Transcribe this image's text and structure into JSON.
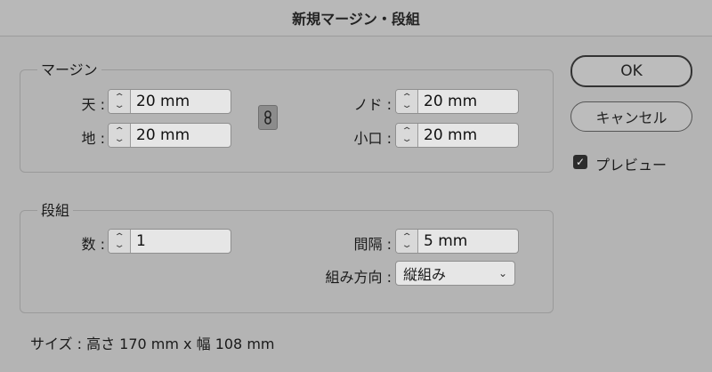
{
  "window": {
    "title": "新規マージン・段組"
  },
  "margins": {
    "group_label": "マージン",
    "top": {
      "label": "天 :",
      "value": "20 mm"
    },
    "bottom": {
      "label": "地 :",
      "value": "20 mm"
    },
    "inside": {
      "label": "ノド :",
      "value": "20 mm"
    },
    "outside": {
      "label": "小口 :",
      "value": "20 mm"
    }
  },
  "columns": {
    "group_label": "段組",
    "count": {
      "label": "数 :",
      "value": "1"
    },
    "gutter": {
      "label": "間隔 :",
      "value": "5 mm"
    },
    "direction": {
      "label": "組み方向 :",
      "value": "縦組み"
    }
  },
  "buttons": {
    "ok": "OK",
    "cancel": "キャンセル"
  },
  "preview": {
    "label": "プレビュー",
    "checked": true
  },
  "size_info": "サイズ : 高さ 170 mm x 幅 108 mm",
  "icons": {
    "spinner": "up-down-arrows-icon",
    "link": "chain-link-icon",
    "dropdown": "chevron-down-icon",
    "check": "checkmark-icon"
  }
}
